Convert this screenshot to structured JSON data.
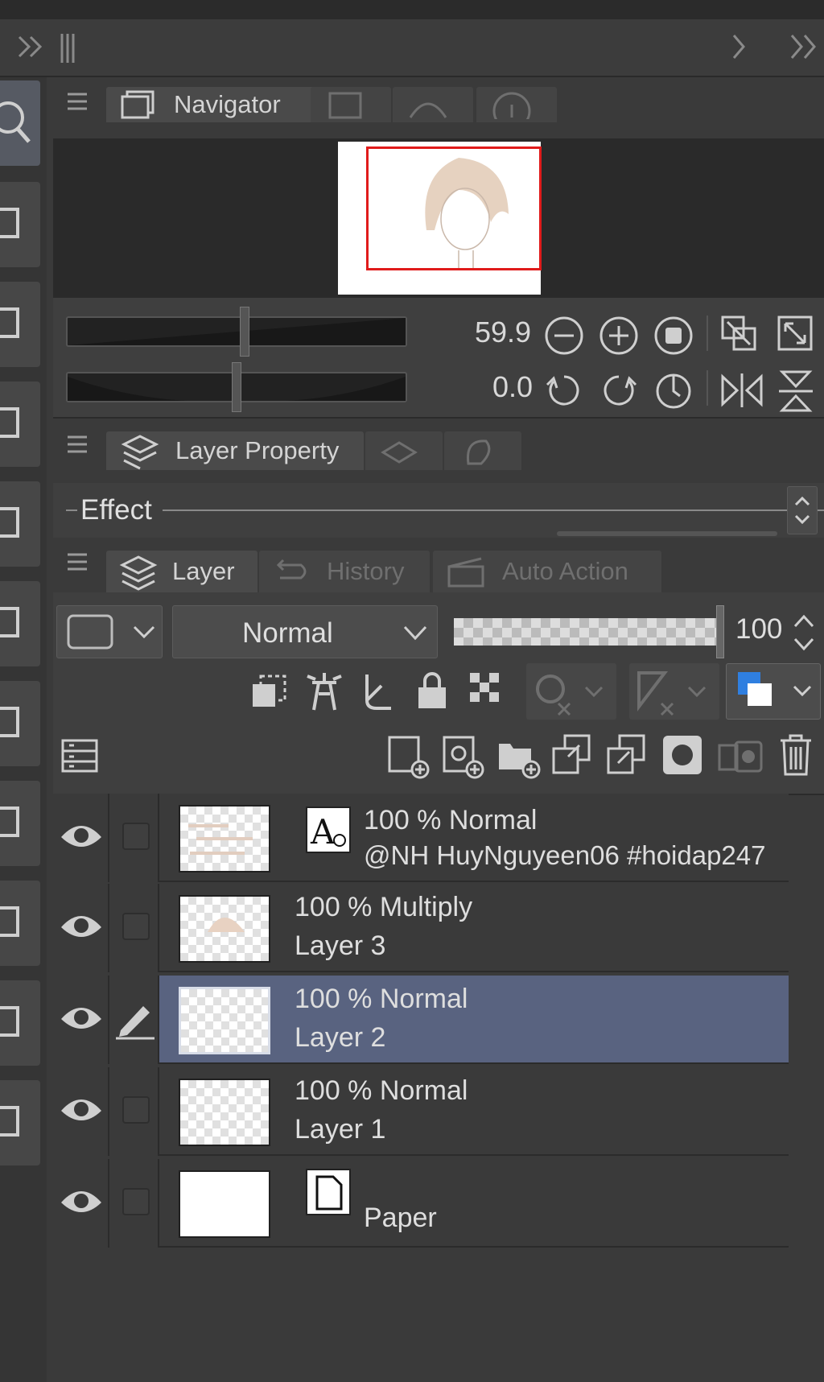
{
  "navigator_tabs": {
    "navigator_label": "Navigator"
  },
  "navigator": {
    "zoom_value": "59.9",
    "rotation_value": "0.0"
  },
  "property_tabs": {
    "layer_property_label": "Layer Property"
  },
  "effect": {
    "label": "Effect"
  },
  "layer_tabs": {
    "layer_label": "Layer",
    "history_label": "History",
    "auto_action_label": "Auto Action"
  },
  "layer_controls": {
    "blend_mode": "Normal",
    "opacity": "100"
  },
  "layers": [
    {
      "line1": "100 % Normal",
      "line2": "@NH HuyNguyeen06 #hoidap247",
      "type": "text"
    },
    {
      "line1": "100 % Multiply",
      "line2": "Layer 3",
      "type": "raster"
    },
    {
      "line1": "100 % Normal",
      "line2": "Layer 2",
      "type": "raster",
      "selected": true
    },
    {
      "line1": "100 % Normal",
      "line2": "Layer 1",
      "type": "raster"
    },
    {
      "line1": "",
      "line2": "Paper",
      "type": "paper"
    }
  ],
  "colors": {
    "selected_layer": "#596380",
    "navigator_frame": "#e01b1b",
    "main_color": "#2f7fe0"
  }
}
